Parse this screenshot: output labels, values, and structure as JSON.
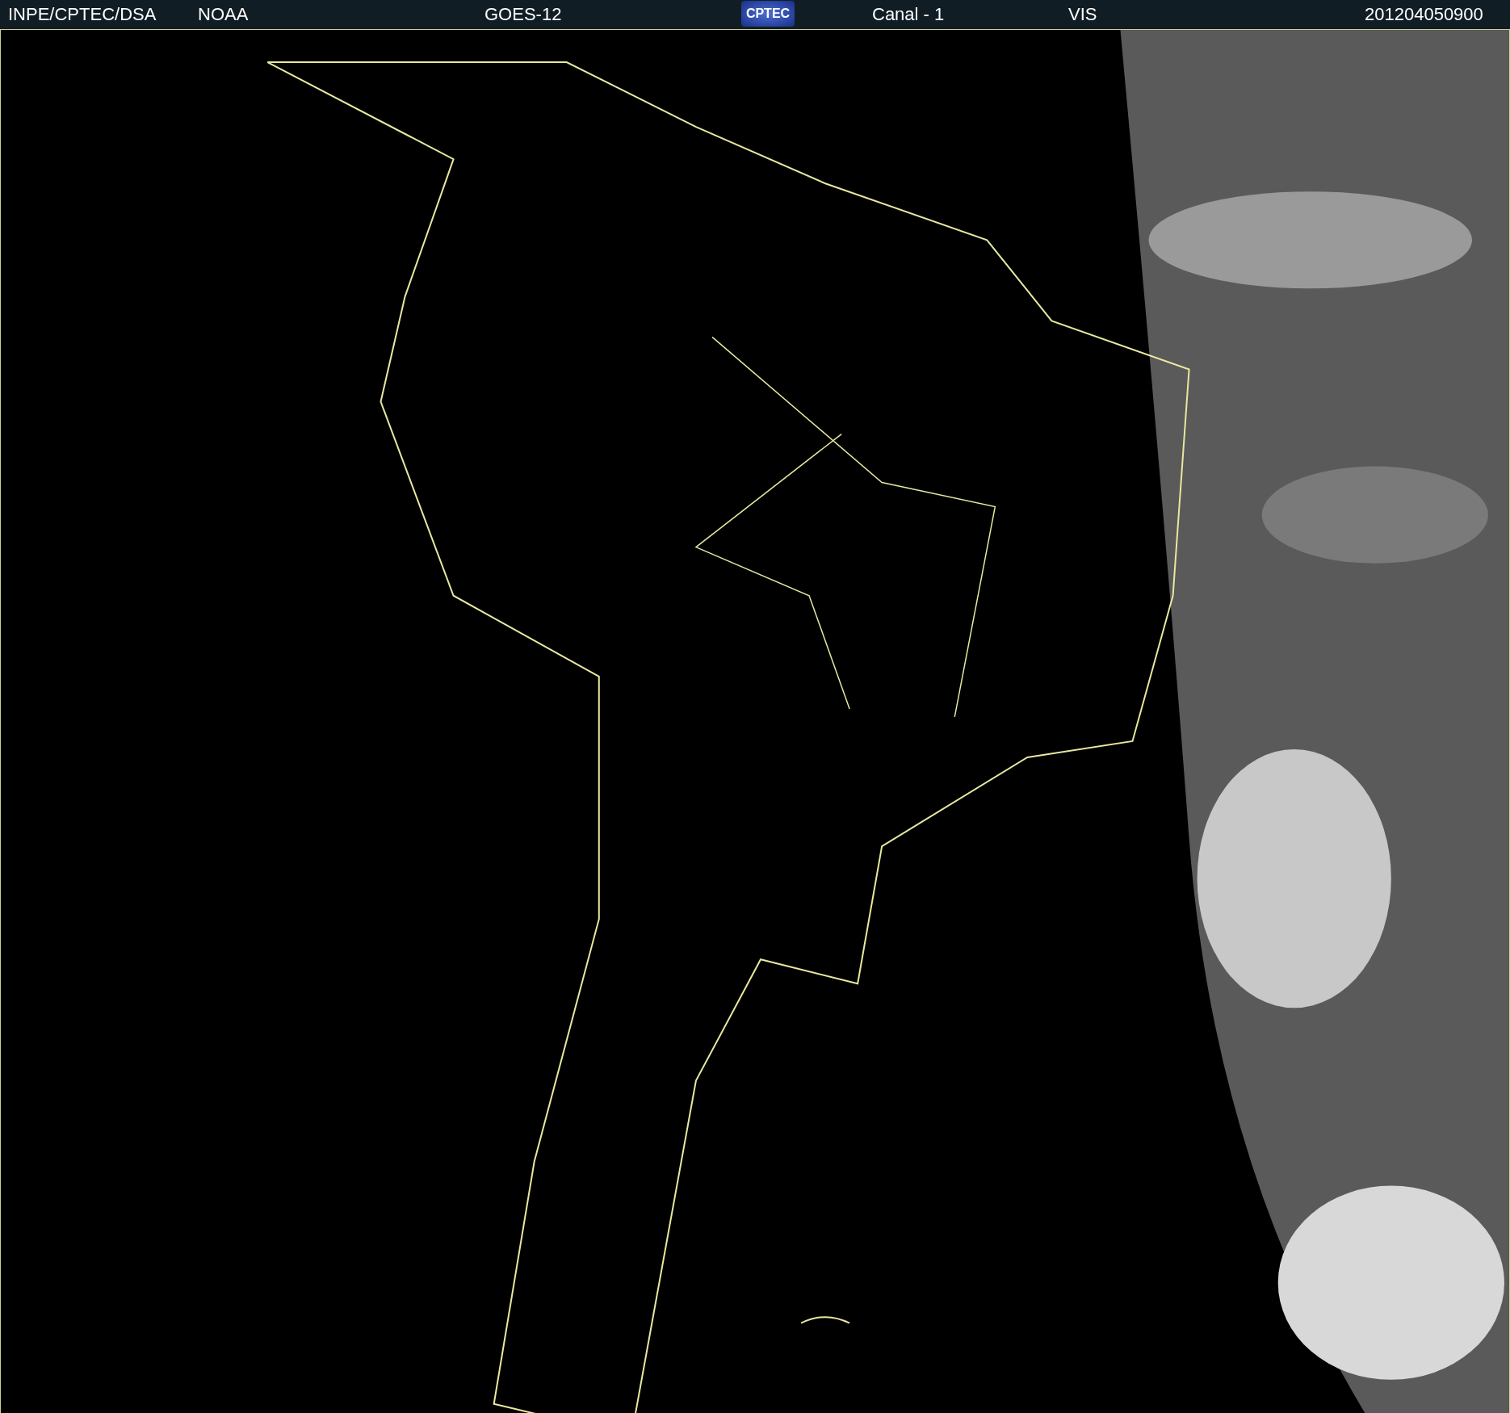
{
  "header": {
    "items": [
      {
        "kind": "text",
        "text": "INPE/CPTEC/DSA"
      },
      {
        "kind": "text",
        "text": "NOAA"
      },
      {
        "kind": "text",
        "text": "GOES-12"
      },
      {
        "kind": "logo",
        "text": "CPTEC"
      },
      {
        "kind": "text",
        "text": "Canal - 1"
      },
      {
        "kind": "text",
        "text": "VIS"
      },
      {
        "kind": "text",
        "text": "201204050900"
      }
    ]
  }
}
